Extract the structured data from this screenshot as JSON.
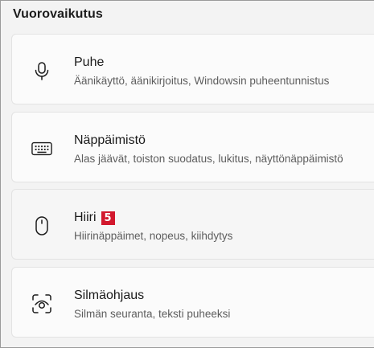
{
  "section": {
    "title": "Vuorovaikutus"
  },
  "items": [
    {
      "id": "puhe",
      "icon": "microphone-icon",
      "title": "Puhe",
      "description": "Äänikäyttö, äänikirjoitus, Windowsin puheentunnistus"
    },
    {
      "id": "nappaimisto",
      "icon": "keyboard-icon",
      "title": "Näppäimistö",
      "description": "Alas jäävät, toiston suodatus, lukitus, näyttönäppäimistö"
    },
    {
      "id": "hiiri",
      "icon": "mouse-icon",
      "title": "Hiiri",
      "badge": "5",
      "description": "Hiirinäppäimet, nopeus, kiihdytys"
    },
    {
      "id": "silmaohjaus",
      "icon": "eye-control-icon",
      "title": "Silmäohjaus",
      "description": "Silmän seuranta, teksti puheeksi"
    }
  ],
  "colors": {
    "badge": "#d2182d",
    "card_background": "#fbfbfb",
    "page_background": "#f3f3f3"
  }
}
